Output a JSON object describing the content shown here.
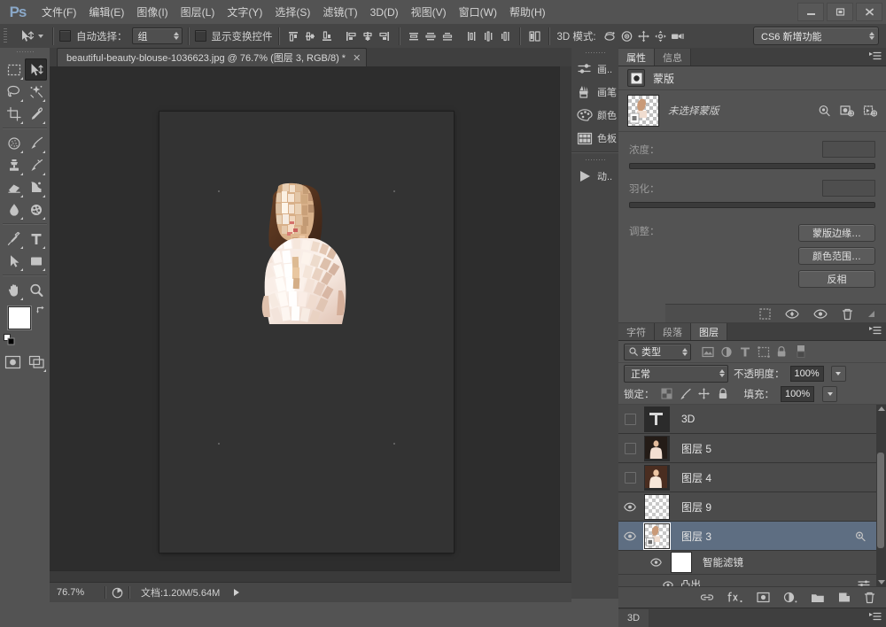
{
  "app": {
    "name": "Ps",
    "logo_color": "#8aa8c8"
  },
  "menu": {
    "items": [
      "文件(F)",
      "编辑(E)",
      "图像(I)",
      "图层(L)",
      "文字(Y)",
      "选择(S)",
      "滤镜(T)",
      "3D(D)",
      "视图(V)",
      "窗口(W)",
      "帮助(H)"
    ]
  },
  "window_controls": {
    "minimize": "minimize-icon",
    "maximize": "maximize-icon",
    "close": "close-icon"
  },
  "options_bar": {
    "tool_icon": "move-tool-icon",
    "auto_select_label": "自动选择：",
    "auto_select_value": "组",
    "auto_select_checked": false,
    "show_transform_label": "显示变换控件",
    "show_transform_checked": false,
    "align_icons": [
      "align-top-edges-icon",
      "align-vertical-centers-icon",
      "align-bottom-edges-icon",
      "align-left-edges-icon",
      "align-horizontal-centers-icon",
      "align-right-edges-icon"
    ],
    "distribute_icons": [
      "distribute-top-edges-icon",
      "distribute-vertical-centers-icon",
      "distribute-bottom-edges-icon",
      "distribute-left-edges-icon",
      "distribute-horizontal-centers-icon",
      "distribute-right-edges-icon"
    ],
    "auto_align_icon": "auto-align-layers-icon",
    "mode3d_label": "3D 模式:",
    "mode3d_icons": [
      "rotate-3d-icon",
      "roll-3d-icon",
      "pan-3d-icon",
      "slide-3d-icon",
      "camera-3d-icon"
    ],
    "workspace_value": "CS6 新增功能"
  },
  "toolbar": {
    "tools": [
      {
        "name": "rectangular-marquee-tool",
        "active": false,
        "flyout": true
      },
      {
        "name": "move-tool",
        "active": true,
        "flyout": false
      },
      {
        "name": "lasso-tool",
        "active": false,
        "flyout": true
      },
      {
        "name": "quick-selection-tool",
        "active": false,
        "flyout": true
      },
      {
        "name": "crop-tool",
        "active": false,
        "flyout": true
      },
      {
        "name": "eyedropper-tool",
        "active": false,
        "flyout": true
      },
      {
        "name": "spot-healing-brush-tool",
        "active": false,
        "flyout": true
      },
      {
        "name": "brush-tool",
        "active": false,
        "flyout": true
      },
      {
        "name": "clone-stamp-tool",
        "active": false,
        "flyout": true
      },
      {
        "name": "history-brush-tool",
        "active": false,
        "flyout": true
      },
      {
        "name": "eraser-tool",
        "active": false,
        "flyout": true
      },
      {
        "name": "gradient-tool",
        "active": false,
        "flyout": true
      },
      {
        "name": "blur-tool",
        "active": false,
        "flyout": true
      },
      {
        "name": "dodge-tool",
        "active": false,
        "flyout": true
      },
      {
        "name": "pen-tool",
        "active": false,
        "flyout": true
      },
      {
        "name": "horizontal-type-tool",
        "active": false,
        "flyout": true
      },
      {
        "name": "path-selection-tool",
        "active": false,
        "flyout": true
      },
      {
        "name": "rectangle-tool",
        "active": false,
        "flyout": true
      },
      {
        "name": "hand-tool",
        "active": false,
        "flyout": true
      },
      {
        "name": "zoom-tool",
        "active": false,
        "flyout": false
      }
    ],
    "foreground_color": "#ffffff",
    "background_color": "#a97168",
    "quick_mask_icon": "quick-mask-icon",
    "screen_mode_icon": "screen-mode-icon",
    "swap_colors_icon": "swap-colors-icon",
    "default_colors_icon": "default-colors-icon"
  },
  "document": {
    "tab_title": "beautiful-beauty-blouse-1036623.jpg @ 76.7% (图层 3, RGB/8) *",
    "close_icon": "close-icon"
  },
  "status_bar": {
    "zoom": "76.7%",
    "doc_icon": "document-info-icon",
    "doc_size": "文档:1.20M/5.64M",
    "expand_icon": "play-arrow-icon"
  },
  "mini_dock": {
    "groups": [
      {
        "items": [
          {
            "label": "画..",
            "icon": "adjustments-icon"
          },
          {
            "label": "画笔",
            "icon": "brush-presets-icon"
          },
          {
            "label": "颜色",
            "icon": "color-panel-icon"
          },
          {
            "label": "色板",
            "icon": "swatches-panel-icon"
          }
        ]
      },
      {
        "items": [
          {
            "label": "动..",
            "icon": "actions-panel-icon"
          }
        ]
      }
    ]
  },
  "properties_panel": {
    "tabs": [
      {
        "label": "属性",
        "selected": true
      },
      {
        "label": "信息",
        "selected": false
      }
    ],
    "menu_icon": "panel-menu-icon",
    "header_title": "蒙版",
    "header_icon": "pixel-mask-icon",
    "mask_state": "未选择蒙版",
    "mask_thumb_icon": "mask-thumbnail",
    "row_icons": [
      "select-mask-icon",
      "pixel-mask-add-icon",
      "vector-mask-add-icon"
    ],
    "density_label": "浓度：",
    "density_value": "",
    "feather_label": "羽化：",
    "feather_value": "",
    "adjust_label": "调整：",
    "buttons": [
      {
        "label": "蒙版边缘…",
        "name": "mask-edge-button"
      },
      {
        "label": "颜色范围…",
        "name": "color-range-button"
      },
      {
        "label": "反相",
        "name": "invert-button"
      }
    ],
    "footer_icons": [
      "load-selection-icon",
      "apply-mask-icon",
      "toggle-mask-icon",
      "delete-mask-icon"
    ]
  },
  "layers_panel": {
    "tabs": [
      {
        "label": "字符",
        "selected": false
      },
      {
        "label": "段落",
        "selected": false
      },
      {
        "label": "图层",
        "selected": true
      }
    ],
    "menu_icon": "panel-menu-icon",
    "filter": {
      "search_icon": "search-icon",
      "kind_label": "类型",
      "toggles": [
        "filter-pixel-icon",
        "filter-adjustment-icon",
        "filter-type-icon",
        "filter-shape-icon",
        "filter-smartobject-icon"
      ],
      "power_icon": "filter-enable-icon"
    },
    "blend_mode": "正常",
    "opacity_label": "不透明度：",
    "opacity_value": "100%",
    "lock_label": "锁定：",
    "lock_icons": [
      "lock-transparent-pixels-icon",
      "lock-image-pixels-icon",
      "lock-position-icon",
      "lock-all-icon"
    ],
    "fill_label": "填充：",
    "fill_value": "100%",
    "layers": [
      {
        "name": "3D",
        "visible": false,
        "selected": false,
        "thumb": "type-layer-T",
        "kind": "type"
      },
      {
        "name": "图层 5",
        "visible": false,
        "selected": false,
        "thumb": "portrait-thumb",
        "kind": "pixel"
      },
      {
        "name": "图层 4",
        "visible": false,
        "selected": false,
        "thumb": "portrait-thumb",
        "kind": "pixel"
      },
      {
        "name": "图层 9",
        "visible": true,
        "selected": false,
        "thumb": "empty-transparent",
        "kind": "pixel"
      },
      {
        "name": "图层 3",
        "visible": true,
        "selected": true,
        "thumb": "smart-object-thumb",
        "kind": "smart-object",
        "badge": "smart-filter-badge-icon"
      }
    ],
    "smart_filters": {
      "group_label": "智能滤镜",
      "group_visible": true,
      "group_thumb": "white-mask-thumb",
      "filters": [
        {
          "label": "凸出",
          "visible": true,
          "settings_icon": "filter-settings-icon"
        }
      ]
    },
    "footer_icons": [
      "link-layers-icon",
      "layer-style-fx-icon",
      "add-layer-mask-icon",
      "new-adjustment-layer-icon",
      "new-group-icon",
      "new-layer-icon",
      "delete-layer-icon"
    ],
    "bottom_tab": "3D",
    "bottom_tab_menu_icon": "panel-menu-icon"
  },
  "canvas": {
    "background_color": "#2d2d2d",
    "artboard_color": "#333333",
    "guide_dots": 4,
    "artwork_description": "extruded-portrait-image"
  }
}
